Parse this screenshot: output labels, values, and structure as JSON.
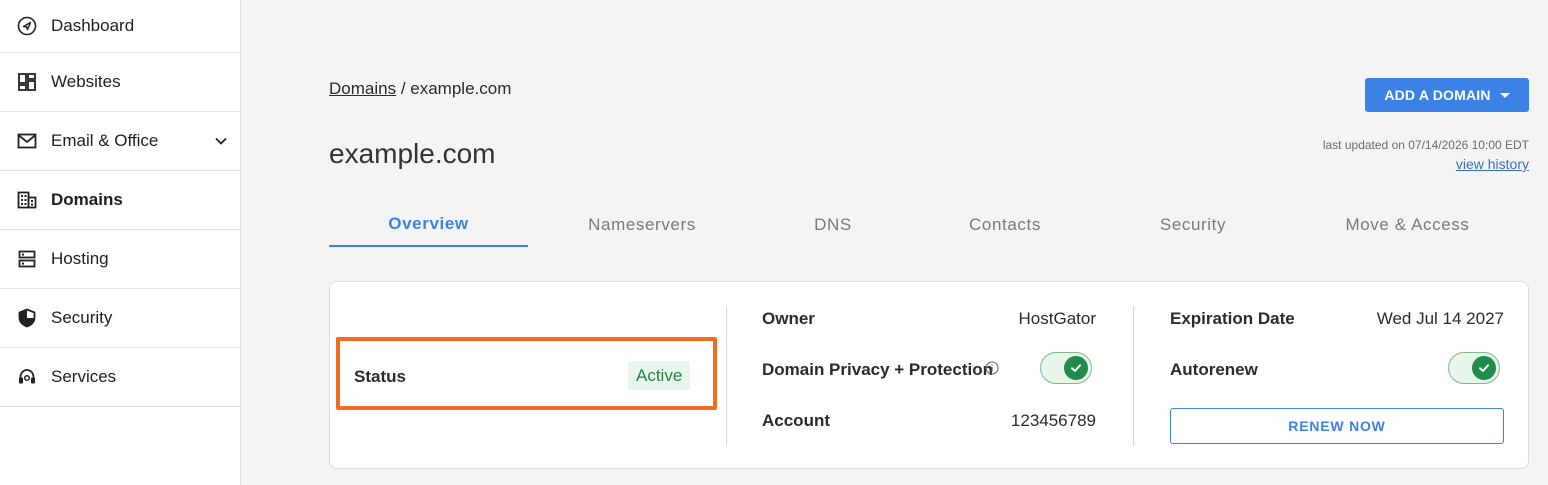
{
  "sidebar": {
    "items": [
      {
        "label": "Dashboard",
        "icon": "compass-icon"
      },
      {
        "label": "Websites",
        "icon": "grid-icon"
      },
      {
        "label": "Email & Office",
        "icon": "envelope-icon"
      },
      {
        "label": "Domains",
        "icon": "building-icon",
        "active": true
      },
      {
        "label": "Hosting",
        "icon": "server-icon"
      },
      {
        "label": "Security",
        "icon": "shield-icon"
      },
      {
        "label": "Services",
        "icon": "headset-icon"
      }
    ]
  },
  "breadcrumb": {
    "parent": "Domains",
    "separator": " / ",
    "current": "example.com"
  },
  "header": {
    "add_domain_label": "ADD A DOMAIN",
    "title": "example.com",
    "last_updated": "last updated on 07/14/2026 10:00 EDT",
    "view_history": "view history"
  },
  "tabs": [
    {
      "label": "Overview",
      "active": true
    },
    {
      "label": "Nameservers"
    },
    {
      "label": "DNS"
    },
    {
      "label": "Contacts"
    },
    {
      "label": "Security"
    },
    {
      "label": "Move & Access"
    }
  ],
  "overview": {
    "status_label": "Status",
    "status_value": "Active",
    "owner_label": "Owner",
    "owner_value": "HostGator",
    "privacy_label": "Domain Privacy + Protection",
    "privacy_enabled": true,
    "account_label": "Account",
    "account_value": "123456789",
    "expiration_label": "Expiration Date",
    "expiration_value": "Wed Jul 14 2027",
    "autorenew_label": "Autorenew",
    "autorenew_enabled": true,
    "renew_label": "RENEW NOW"
  },
  "colors": {
    "accent": "#3c82e6",
    "highlight": "#f26b21",
    "status_bg": "#e7f6ec",
    "status_text": "#2e7d46",
    "toggle_on": "#1f8c4b"
  }
}
